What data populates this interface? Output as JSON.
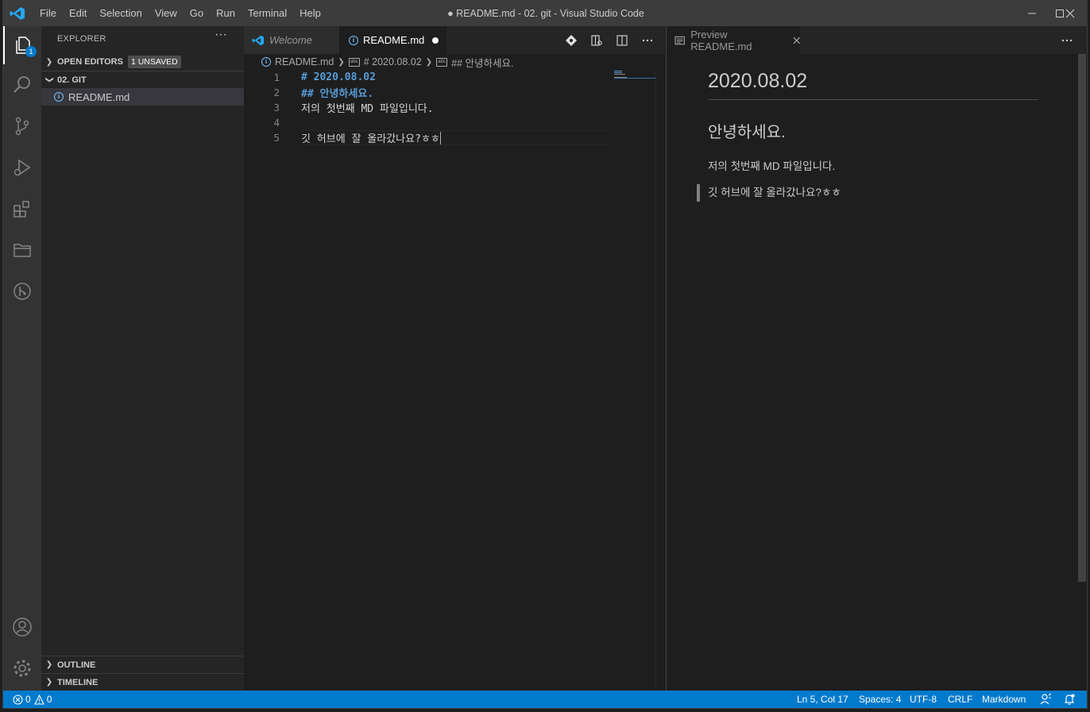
{
  "titlebar": {
    "menu": [
      "File",
      "Edit",
      "Selection",
      "View",
      "Go",
      "Run",
      "Terminal",
      "Help"
    ],
    "window_title": "● README.md - 02. git - Visual Studio Code"
  },
  "activity_bar": {
    "explorer_badge": "1",
    "icons": [
      "files-icon",
      "search-icon",
      "source-control-icon",
      "run-debug-icon",
      "extensions-icon",
      "folder-icon",
      "git-graph-icon",
      "account-icon",
      "settings-gear-icon"
    ]
  },
  "sidebar": {
    "title": "EXPLORER",
    "more": "···",
    "open_editors": {
      "label": "OPEN EDITORS",
      "badge": "1 UNSAVED"
    },
    "folder": {
      "label": "02. GIT",
      "files": [
        {
          "name": "README.md"
        }
      ]
    },
    "outline": "OUTLINE",
    "timeline": "TIMELINE"
  },
  "editor": {
    "tabs": [
      {
        "label": "Welcome",
        "active": false
      },
      {
        "label": "README.md",
        "active": true,
        "dirty": true
      }
    ],
    "breadcrumb": [
      "README.md",
      "# 2020.08.02",
      "## 안녕하세요."
    ],
    "lines": [
      {
        "num": "1",
        "text": "# 2020.08.02"
      },
      {
        "num": "2",
        "text": "## 안녕하세요."
      },
      {
        "num": "3",
        "text": "저의 첫번째 MD 파일입니다."
      },
      {
        "num": "4",
        "text": ""
      },
      {
        "num": "5",
        "text": "깃 허브에 잘 올라갔나요?ㅎㅎ"
      }
    ]
  },
  "preview": {
    "tab_label": "Preview README.md",
    "h1": "2020.08.02",
    "h2": "안녕하세요.",
    "paragraph": "저의 첫번째 MD 파일입니다.",
    "quote": "깃 허브에 잘 올라갔나요?ㅎㅎ"
  },
  "statusbar": {
    "errors": "0",
    "warnings": "0",
    "position": "Ln 5, Col 17",
    "spaces": "Spaces: 4",
    "encoding": "UTF-8",
    "eol": "CRLF",
    "language": "Markdown"
  },
  "colors": {
    "accent": "#007acc",
    "heading": "#569cd6",
    "titlebar": "#3c3c3c",
    "activity": "#333333",
    "sidebar": "#252526",
    "editor": "#1e1e1e"
  }
}
